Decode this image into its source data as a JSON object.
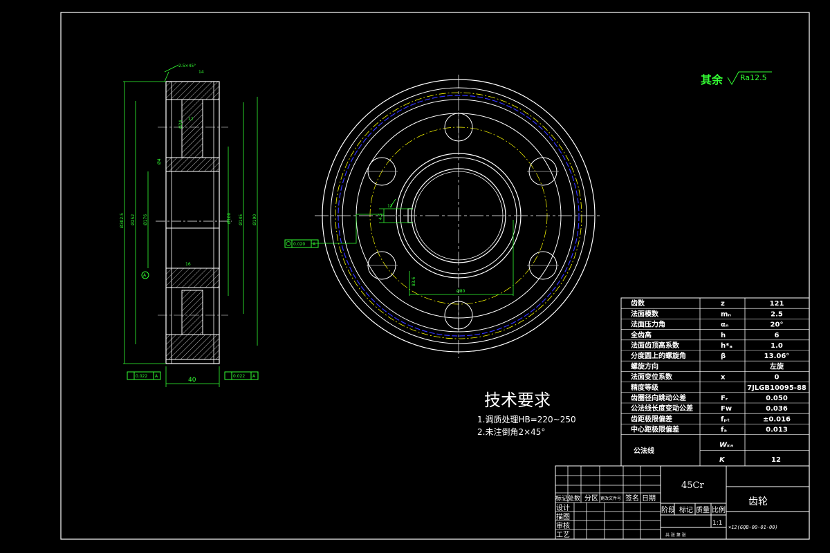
{
  "surface_finish": {
    "label": "其余",
    "value": "Ra12.5"
  },
  "tech_requirements": {
    "title": "技术要求",
    "items": [
      "1.调质处理HB=220~250",
      "2.未注倒角2×45°"
    ]
  },
  "section_dims": {
    "chamfer": "2.5×45°",
    "top_width": "14",
    "hub_d": "Ø24",
    "rib": "12",
    "groove": "Ø4",
    "d1": "Ø302.5",
    "d2": "Ø252",
    "d3": "Ø176",
    "d4": "Ø100",
    "d5": "Ø145",
    "d6": "Ø190",
    "width": "40",
    "hub_w": "16",
    "tol_left": {
      "val": "0.022",
      "ref": "A"
    },
    "tol_right": {
      "val": "0.022",
      "ref": "A"
    },
    "datum": "A"
  },
  "front_dims": {
    "key_a": "4.5",
    "key_b": "12",
    "key_c": "83.6",
    "bore": "Ø80",
    "tol_circ": {
      "val": "0.020",
      "ref": "A"
    }
  },
  "params_table": [
    {
      "name": "齿数",
      "symbol": "z",
      "value": "121"
    },
    {
      "name": "法面模数",
      "symbol": "mₙ",
      "value": "2.5"
    },
    {
      "name": "法面压力角",
      "symbol": "αₙ",
      "value": "20°"
    },
    {
      "name": "全齿高",
      "symbol": "h",
      "value": "6"
    },
    {
      "name": "法面齿顶高系数",
      "symbol": "h*ₐ",
      "value": "1.0"
    },
    {
      "name": "分度圆上的螺旋角",
      "symbol": "β",
      "value": "13.06°"
    },
    {
      "name": "螺旋方向",
      "symbol": "",
      "value": "左旋"
    },
    {
      "name": "法面变位系数",
      "symbol": "x",
      "value": "0"
    },
    {
      "name": "精度等级",
      "symbol": "",
      "value": "7JLGB10095-88"
    },
    {
      "name": "齿圈径向跳动公差",
      "symbol": "Fᵣ",
      "value": "0.050"
    },
    {
      "name": "公法线长度变动公差",
      "symbol": "Fw",
      "value": "0.036"
    },
    {
      "name": "齿距极限偏差",
      "symbol": "fₚₜ",
      "value": "±0.016"
    },
    {
      "name": "中心距极限偏差",
      "symbol": "fₐ",
      "value": "0.013"
    }
  ],
  "common_normal": {
    "label": "公法线",
    "w_symbol": "Wₖₙ",
    "k_symbol": "K",
    "k_value": "12"
  },
  "title_block": {
    "material": "45Cr",
    "part_name": "齿轮",
    "revision_headers": [
      "标记",
      "处数",
      "分区",
      "更改文件号",
      "签名",
      "日期"
    ],
    "roles": [
      "设计",
      "描图",
      "审核",
      "工艺"
    ],
    "stage_headers": [
      "阶段",
      "标记",
      "质量",
      "比例"
    ],
    "scale": "1:1",
    "sheet_label": "共 张 第 张",
    "drawing_no": "×12(GQB-00-01-00)"
  },
  "colors": {
    "background": "#000000",
    "frame": "#ffffff",
    "dimension": "#00ff00",
    "pitch_circle": "#ffff00",
    "root_circle": "#0000ff",
    "text_green": "#33ff33"
  }
}
